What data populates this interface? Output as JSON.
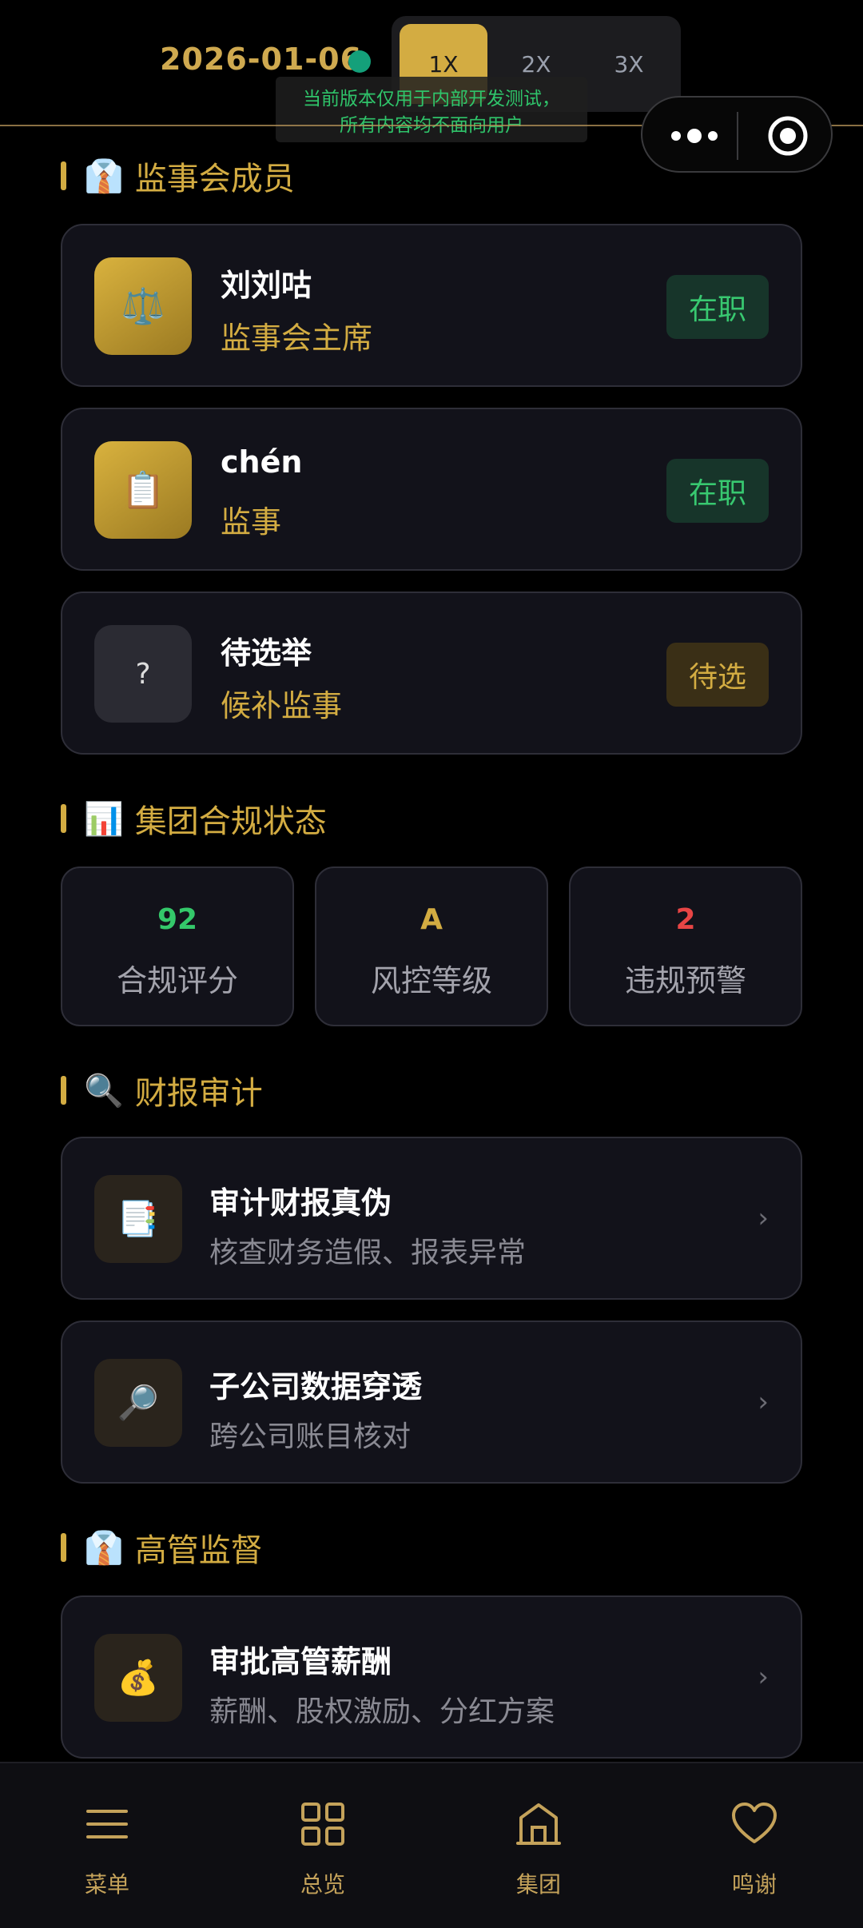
{
  "topbar": {
    "date": "2026-01-06",
    "speeds": [
      "1X",
      "2X",
      "3X"
    ],
    "dev_notice_line1": "当前版本仅用于内部开发测试，",
    "dev_notice_line2": "所有内容均不面向用户"
  },
  "supervisors": {
    "title": "监事会成员",
    "emoji": "👔",
    "members": [
      {
        "name": "刘刘咕",
        "role": "监事会主席",
        "status": "在职",
        "icon": "⚖️"
      },
      {
        "name": "chén",
        "role": "监事",
        "status": "在职",
        "icon": "📋"
      },
      {
        "name": "待选举",
        "role": "候补监事",
        "status": "待选",
        "icon": "?"
      }
    ]
  },
  "compliance": {
    "title": "集团合规状态",
    "emoji": "📊",
    "stats": [
      {
        "value": "92",
        "label": "合规评分",
        "color": "#34c86a"
      },
      {
        "value": "A",
        "label": "风控等级",
        "color": "#d3ac42"
      },
      {
        "value": "2",
        "label": "违规预警",
        "color": "#e84545"
      }
    ]
  },
  "audit": {
    "title": "财报审计",
    "emoji": "🔍",
    "items": [
      {
        "title": "审计财报真伪",
        "subtitle": "核查财务造假、报表异常",
        "icon": "📑"
      },
      {
        "title": "子公司数据穿透",
        "subtitle": "跨公司账目核对",
        "icon": "🔎"
      }
    ]
  },
  "executive": {
    "title": "高管监督",
    "emoji": "👔",
    "items": [
      {
        "title": "审批高管薪酬",
        "subtitle": "薪酬、股权激励、分红方案",
        "icon": "💰"
      }
    ]
  },
  "nav": {
    "items": [
      {
        "label": "菜单",
        "icon": "menu-icon"
      },
      {
        "label": "总览",
        "icon": "grid-icon"
      },
      {
        "label": "集团",
        "icon": "building-icon"
      },
      {
        "label": "鸣谢",
        "icon": "heart-icon"
      }
    ]
  },
  "chevron": "›",
  "colors": {
    "accent": "#d3ac42",
    "active": "#38c870",
    "warn": "#e84545"
  }
}
